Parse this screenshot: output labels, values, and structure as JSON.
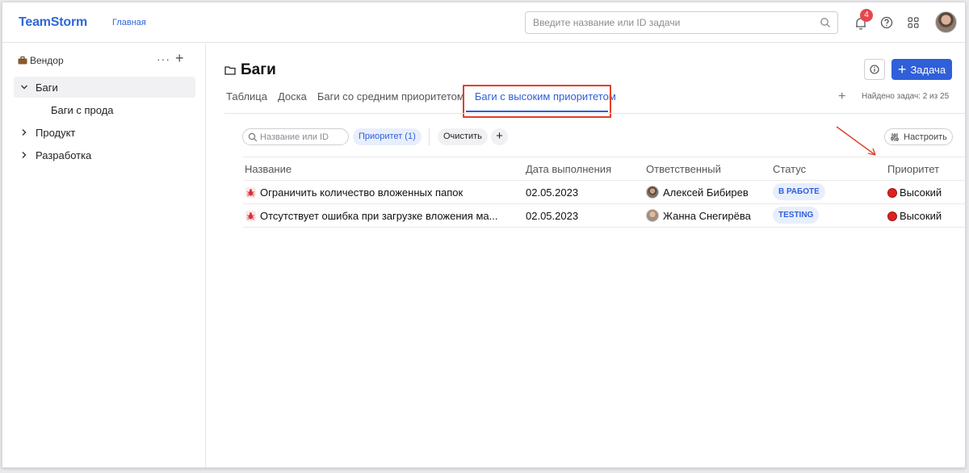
{
  "header": {
    "logo": "TeamStorm",
    "home_link": "Главная",
    "search_placeholder": "Введите название или ID задачи",
    "notification_count": "4"
  },
  "sidebar": {
    "space": "Вендор",
    "items": [
      {
        "label": "Баги",
        "expanded": true,
        "active": true
      },
      {
        "label": "Продукт",
        "expanded": false
      },
      {
        "label": "Разработка",
        "expanded": false
      }
    ],
    "sub_items": [
      "Баги с прода"
    ]
  },
  "main": {
    "title": "Баги",
    "new_task_label": "Задача",
    "tabs": [
      {
        "label": "Таблица",
        "active": false
      },
      {
        "label": "Доска",
        "active": false
      },
      {
        "label": "Баги со средним приоритетом",
        "active": false
      },
      {
        "label": "Баги с высоким приоритетом",
        "active": true
      }
    ],
    "found_text": "Найдено задач: 2 из 25"
  },
  "filters": {
    "search_placeholder": "Название или ID",
    "priority_chip": "Приоритет (1)",
    "clear_label": "Очистить",
    "configure_label": "Настроить"
  },
  "table": {
    "columns": [
      "Название",
      "Дата выполнения",
      "Ответственный",
      "Статус",
      "Приоритет"
    ],
    "rows": [
      {
        "name": "Ограничить количество вложенных папок",
        "due": "02.05.2023",
        "owner": "Алексей Бибирев",
        "status": "В РАБОТЕ",
        "priority": "Высокий"
      },
      {
        "name": "Отсутствует ошибка при загрузке вложения ма...",
        "due": "02.05.2023",
        "owner": "Жанна Снегирёва",
        "status": "TESTING",
        "priority": "Высокий"
      }
    ]
  },
  "colors": {
    "accent": "#2f5fd9",
    "highlight": "#e0402a",
    "priority_high": "#e02020",
    "badge": "#e5484d"
  }
}
